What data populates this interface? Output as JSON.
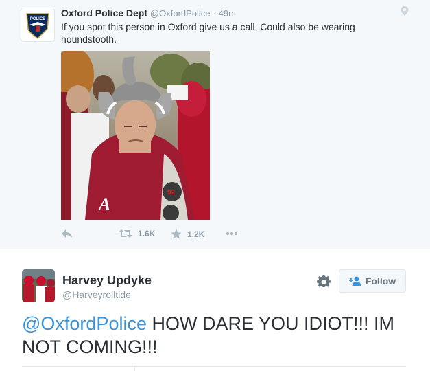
{
  "embedded_tweet": {
    "display_name": "Oxford Police Dept",
    "handle": "@OxfordPolice",
    "separator": "·",
    "time": "49m",
    "text": "If you spot this person in Oxford give us a call. Could also be wearing houndstooth.",
    "avatar_badge_text": "POLICE",
    "retweet_count": "1.6K",
    "favorite_count": "1.2K",
    "photo_description_icon": "photo-icon"
  },
  "main_tweet": {
    "display_name": "Harvey Updyke",
    "handle": "@Harveyrolltide",
    "mention": "@OxfordPolice",
    "text": " HOW DARE YOU IDIOT!!! IM NOT COMING!!!",
    "follow_label": "Follow"
  },
  "colors": {
    "link": "#3b94d9",
    "muted": "#8899a6",
    "text": "#292f33",
    "embedded_bg": "#f5f8fa",
    "crimson": "#9e1b32"
  }
}
